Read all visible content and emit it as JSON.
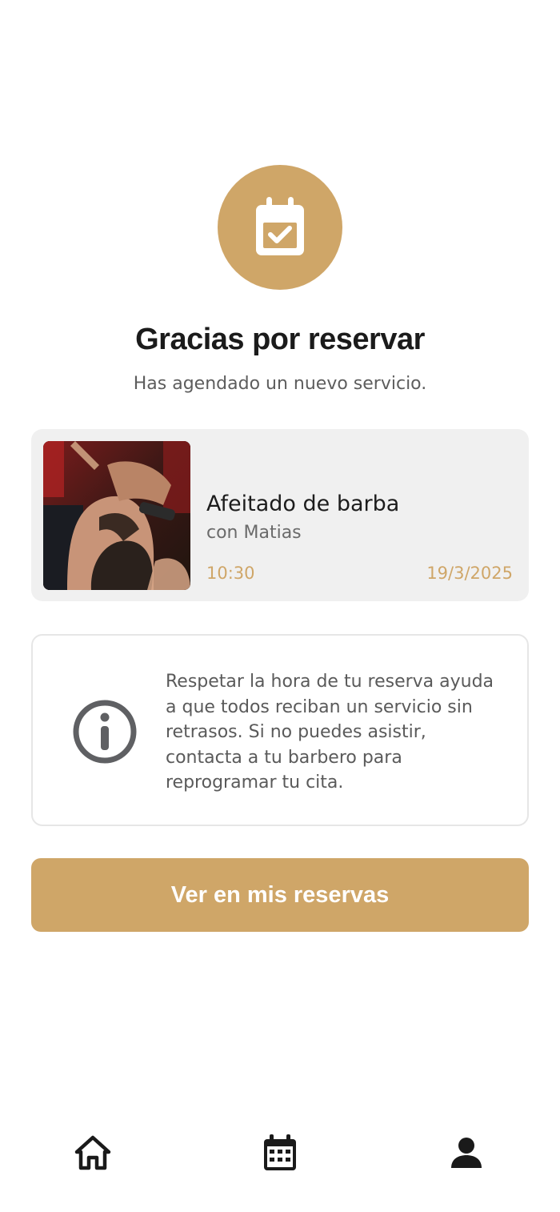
{
  "confirmation": {
    "icon": "calendar-check-icon",
    "title": "Gracias por reservar",
    "subtitle": "Has agendado un nuevo servicio."
  },
  "booking": {
    "service": "Afeitado de barba",
    "barber": "con Matias",
    "time": "10:30",
    "date": "19/3/2025",
    "photo": "barber-shaving-photo"
  },
  "notice": {
    "icon": "info-icon",
    "text": "Respetar la hora de tu reserva ayuda a que todos reciban un servicio sin retrasos. Si no puedes asistir, contacta a tu barbero para reprogramar tu cita."
  },
  "cta": {
    "label": "Ver en mis reservas"
  },
  "nav": {
    "items": [
      {
        "icon": "home-icon"
      },
      {
        "icon": "calendar-icon"
      },
      {
        "icon": "profile-icon"
      }
    ]
  },
  "colors": {
    "accent": "#cfa668",
    "card_bg": "#f0f0f0",
    "title": "#1b1b1b",
    "muted_text": "#5d5d5d"
  }
}
